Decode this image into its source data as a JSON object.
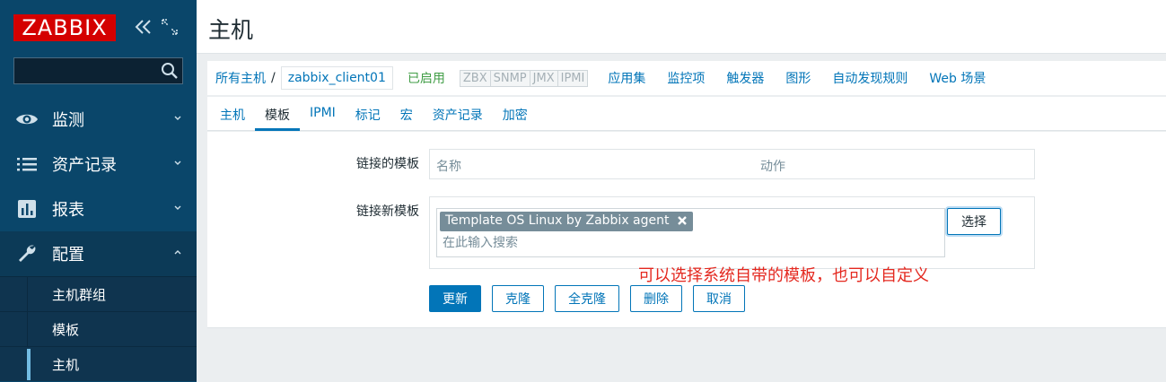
{
  "app": {
    "logo_text": "ZABBIX"
  },
  "sidebar": {
    "search": {
      "value": "",
      "placeholder": ""
    },
    "menu": [
      {
        "label": "监测",
        "icon": "eye-icon",
        "expanded": false
      },
      {
        "label": "资产记录",
        "icon": "list-icon",
        "expanded": false
      },
      {
        "label": "报表",
        "icon": "bar-chart-icon",
        "expanded": false
      },
      {
        "label": "配置",
        "icon": "wrench-icon",
        "expanded": true
      }
    ],
    "submenu": [
      {
        "label": "主机群组",
        "active": false
      },
      {
        "label": "模板",
        "active": false
      },
      {
        "label": "主机",
        "active": true
      }
    ]
  },
  "header": {
    "title": "主机"
  },
  "hostnav": {
    "all_hosts": "所有主机",
    "separator": "/",
    "current_host": "zabbix_client01",
    "status": "已启用",
    "availability": [
      "ZBX",
      "SNMP",
      "JMX",
      "IPMI"
    ],
    "links": [
      "应用集",
      "监控项",
      "触发器",
      "图形",
      "自动发现规则",
      "Web 场景"
    ]
  },
  "tabs": [
    {
      "label": "主机",
      "active": false
    },
    {
      "label": "模板",
      "active": true
    },
    {
      "label": "IPMI",
      "active": false
    },
    {
      "label": "标记",
      "active": false
    },
    {
      "label": "宏",
      "active": false
    },
    {
      "label": "资产记录",
      "active": false
    },
    {
      "label": "加密",
      "active": false
    }
  ],
  "form": {
    "linked_templates_label": "链接的模板",
    "linked_table": {
      "col_name": "名称",
      "col_action": "动作"
    },
    "new_templates_label": "链接新模板",
    "selected_template": "Template OS Linux by Zabbix agent",
    "search_placeholder": "在此输入搜索",
    "select_button": "选择",
    "annotation": "可以选择系统自带的模板，也可以自定义"
  },
  "actions": {
    "update": "更新",
    "clone": "克隆",
    "full_clone": "全克隆",
    "delete": "删除",
    "cancel": "取消"
  },
  "colors": {
    "sidebar_bg": "#0a466a",
    "logo_bg": "#d40000",
    "link": "#0275b8",
    "enabled": "#429e47",
    "annotation": "#e4281f"
  }
}
